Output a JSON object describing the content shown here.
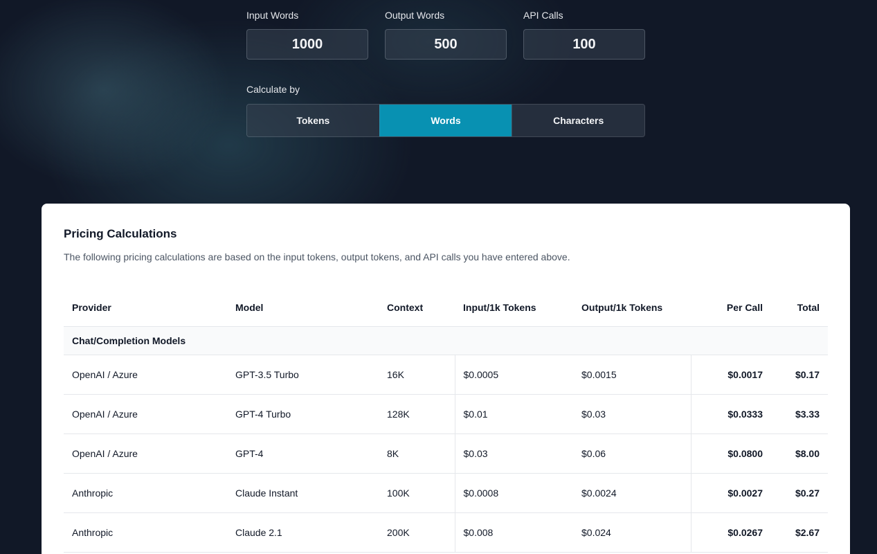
{
  "inputs": [
    {
      "label": "Input Words",
      "value": "1000"
    },
    {
      "label": "Output Words",
      "value": "500"
    },
    {
      "label": "API Calls",
      "value": "100"
    }
  ],
  "calculate": {
    "label": "Calculate by",
    "options": [
      "Tokens",
      "Words",
      "Characters"
    ],
    "selected": "Words"
  },
  "pricing": {
    "title": "Pricing Calculations",
    "description": "The following pricing calculations are based on the input tokens, output tokens, and API calls you have entered above.",
    "columns": [
      "Provider",
      "Model",
      "Context",
      "Input/1k Tokens",
      "Output/1k Tokens",
      "Per Call",
      "Total"
    ],
    "group": "Chat/Completion Models",
    "rows": [
      {
        "provider": "OpenAI / Azure",
        "model": "GPT-3.5 Turbo",
        "context": "16K",
        "input": "$0.0005",
        "output": "$0.0015",
        "per_call": "$0.0017",
        "total": "$0.17"
      },
      {
        "provider": "OpenAI / Azure",
        "model": "GPT-4 Turbo",
        "context": "128K",
        "input": "$0.01",
        "output": "$0.03",
        "per_call": "$0.0333",
        "total": "$3.33"
      },
      {
        "provider": "OpenAI / Azure",
        "model": "GPT-4",
        "context": "8K",
        "input": "$0.03",
        "output": "$0.06",
        "per_call": "$0.0800",
        "total": "$8.00"
      },
      {
        "provider": "Anthropic",
        "model": "Claude Instant",
        "context": "100K",
        "input": "$0.0008",
        "output": "$0.0024",
        "per_call": "$0.0027",
        "total": "$0.27"
      },
      {
        "provider": "Anthropic",
        "model": "Claude 2.1",
        "context": "200K",
        "input": "$0.008",
        "output": "$0.024",
        "per_call": "$0.0267",
        "total": "$2.67"
      }
    ]
  }
}
